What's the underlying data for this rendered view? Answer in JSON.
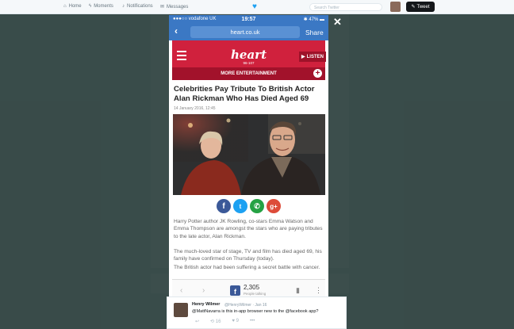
{
  "twitter_nav": {
    "home_label": "Home",
    "moments_label": "Moments",
    "notifications_label": "Notifications",
    "messages_label": "Messages",
    "search_placeholder": "Search Twitter",
    "tweet_button": "Tweet"
  },
  "phone_status": {
    "carrier": "vodafone UK",
    "time": "19:57",
    "battery": "47%"
  },
  "browser": {
    "url": "heart.co.uk",
    "share_label": "Share"
  },
  "site": {
    "logo": "heart",
    "frequency": "96-107",
    "listen_label": "LISTEN",
    "subnav_label": "MORE ENTERTAINMENT"
  },
  "article": {
    "headline": "Celebrities Pay Tribute To British Actor Alan Rickman Who Has Died Aged 69",
    "date": "14 January 2016, 12:45",
    "paragraphs": [
      "Harry Potter author JK Rowling, co-stars Emma Watson and Emma Thompson are amongst the stars who are paying tributes to the late actor, Alan Rickman.",
      "The much-loved star of stage, TV and film has died aged 69, his family have confirmed on Thursday (today).",
      "The British actor had been suffering a secret battle with cancer."
    ]
  },
  "bottom_bar": {
    "count": "2,305",
    "count_label": "People talking"
  },
  "tweet": {
    "name": "Henry Wilmer",
    "handle": "@HenryWilmer · Jan 16",
    "text": "@MattNavarra is this in-app browser new to the @facebook app?",
    "retweets": "16",
    "likes": "9"
  }
}
